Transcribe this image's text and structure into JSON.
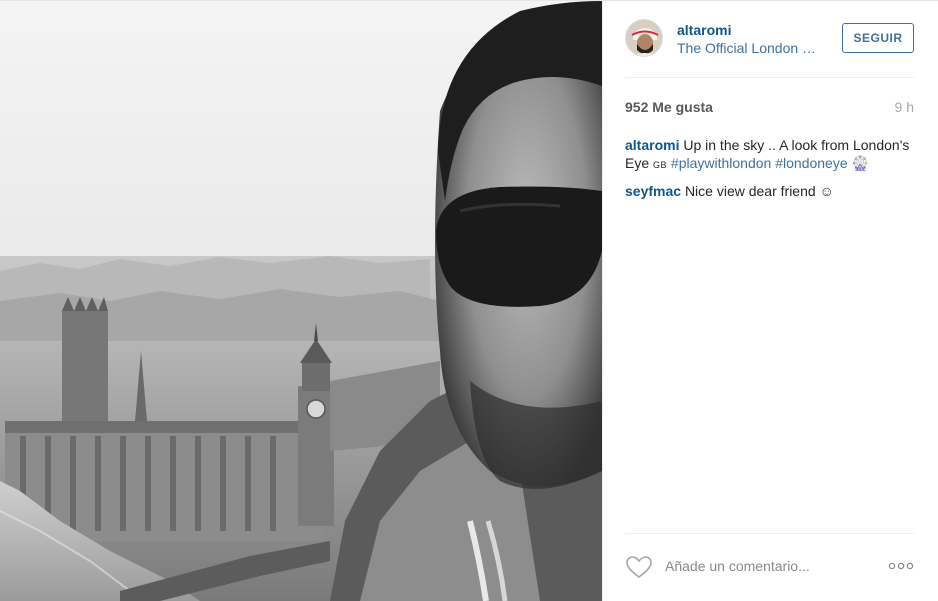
{
  "header": {
    "username": "altaromi",
    "location": "The Official London …",
    "follow_label": "SEGUIR"
  },
  "stats": {
    "likes": "952 Me gusta",
    "time_ago": "9 h"
  },
  "comments": [
    {
      "user": "altaromi",
      "text_1": "Up in the sky .. A look from London's Eye",
      "flag": "GB",
      "tag_1": "#playwithlondon",
      "tag_2": "#londoneye",
      "emoji": "🎡"
    },
    {
      "user": "seyfmac",
      "text": "Nice view dear friend",
      "emoji": "☺"
    }
  ],
  "footer": {
    "comment_placeholder": "Añade un comentario...",
    "like_icon": "heart-icon",
    "more_icon": "more-options-icon"
  },
  "colors": {
    "username": "#125688",
    "link": "#3f729b",
    "muted": "#a5a7aa"
  }
}
